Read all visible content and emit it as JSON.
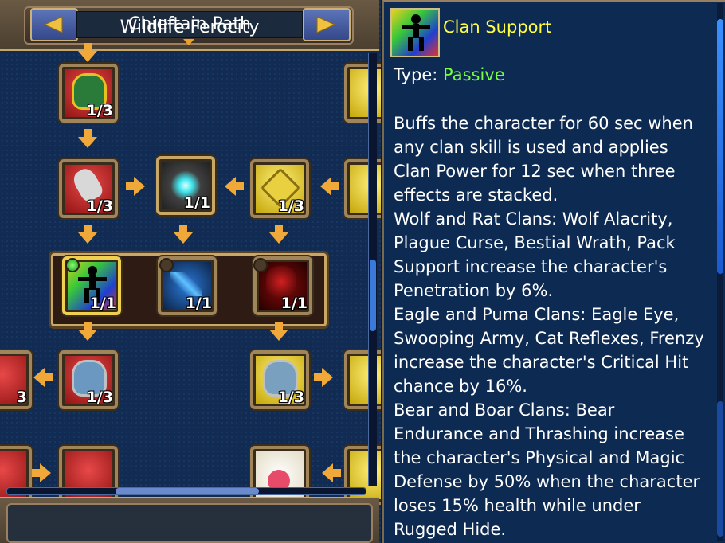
{
  "header": {
    "title": "Chieftain Path",
    "prev_icon": "left-arrow-icon",
    "next_icon": "right-arrow-icon"
  },
  "tree": {
    "skills": [
      {
        "id": "crowned-beast",
        "level": "1/3",
        "color": "red"
      },
      {
        "id": "clan-left-edge",
        "level": "",
        "color": "yellow"
      },
      {
        "id": "red-axe",
        "level": "1/3",
        "color": "red"
      },
      {
        "id": "glow-orb",
        "level": "1/1",
        "color": "dark"
      },
      {
        "id": "gold-sigil",
        "level": "1/3",
        "color": "yellow"
      },
      {
        "id": "clan-support",
        "level": "1/1",
        "color": "multi"
      },
      {
        "id": "blue-claw",
        "level": "1/1",
        "color": "blue"
      },
      {
        "id": "crimson-rage",
        "level": "1/1",
        "color": "crimson"
      },
      {
        "id": "horned-helm-red",
        "level": "1/3",
        "color": "red"
      },
      {
        "id": "horned-helm-yellow",
        "level": "1/3",
        "color": "yellow"
      },
      {
        "id": "edge-left-red",
        "level": "3",
        "color": "red"
      },
      {
        "id": "red-blade-partial",
        "level": "",
        "color": "red"
      },
      {
        "id": "white-cross-partial",
        "level": "",
        "color": "white"
      }
    ]
  },
  "footer": {
    "title": "Wildlife Ferocity"
  },
  "tooltip": {
    "name": "Clan Support",
    "type_label": "Type:",
    "type_value": "Passive",
    "description": "Buffs the character for 60 sec when any clan skill is used and applies Clan Power for 12 sec when three effects are stacked.\nWolf and Rat Clans: Wolf Alacrity, Plague Curse, Bestial Wrath, Pack Support increase the character's Penetration by 6%.\nEagle and Puma Clans: Eagle Eye, Swooping Army, Cat Reflexes, Frenzy increase the character's Critical Hit chance by 16%.\nBear and Boar Clans: Bear Endurance and Thrashing increase the character's Physical and Magic Defense by 50% when the character loses 15% health while under Rugged Hide.",
    "name_color": "#ffff40",
    "type_color": "#7aff40"
  }
}
